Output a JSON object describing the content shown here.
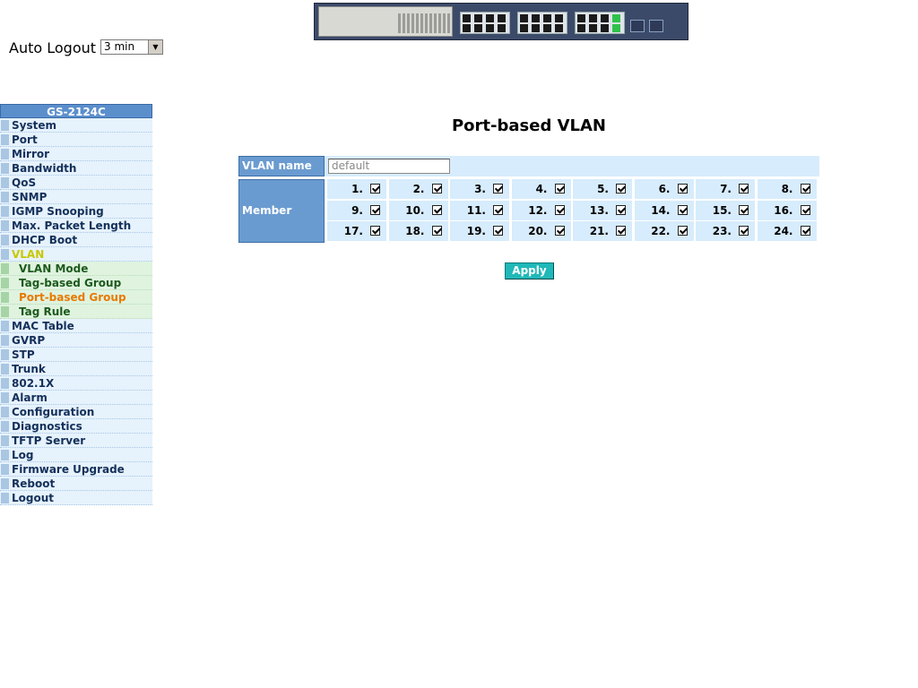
{
  "auto_logout": {
    "label": "Auto Logout",
    "selected": "3 min"
  },
  "sidebar": {
    "title": "GS-2124C",
    "items": [
      {
        "label": "System"
      },
      {
        "label": "Port"
      },
      {
        "label": "Mirror"
      },
      {
        "label": "Bandwidth"
      },
      {
        "label": "QoS"
      },
      {
        "label": "SNMP"
      },
      {
        "label": "IGMP Snooping"
      },
      {
        "label": "Max. Packet Length"
      },
      {
        "label": "DHCP Boot"
      },
      {
        "label": "VLAN"
      },
      {
        "label": "VLAN Mode"
      },
      {
        "label": "Tag-based Group"
      },
      {
        "label": "Port-based Group"
      },
      {
        "label": "Tag Rule"
      },
      {
        "label": "MAC Table"
      },
      {
        "label": "GVRP"
      },
      {
        "label": "STP"
      },
      {
        "label": "Trunk"
      },
      {
        "label": "802.1X"
      },
      {
        "label": "Alarm"
      },
      {
        "label": "Configuration"
      },
      {
        "label": "Diagnostics"
      },
      {
        "label": "TFTP Server"
      },
      {
        "label": "Log"
      },
      {
        "label": "Firmware Upgrade"
      },
      {
        "label": "Reboot"
      },
      {
        "label": "Logout"
      }
    ]
  },
  "main": {
    "title": "Port-based VLAN",
    "vlan_name_label": "VLAN name",
    "vlan_name_value": "default",
    "member_label": "Member",
    "ports": [
      "1.",
      "2.",
      "3.",
      "4.",
      "5.",
      "6.",
      "7.",
      "8.",
      "9.",
      "10.",
      "11.",
      "12.",
      "13.",
      "14.",
      "15.",
      "16.",
      "17.",
      "18.",
      "19.",
      "20.",
      "21.",
      "22.",
      "23.",
      "24."
    ],
    "ports_checked": true,
    "apply_label": "Apply"
  },
  "colors": {
    "header_blue": "#6a9bd0",
    "row_bg": "#d7ecfc",
    "apply_teal": "#20b8b8",
    "active_menu": "#c8c800",
    "current_submenu": "#e87a00"
  }
}
